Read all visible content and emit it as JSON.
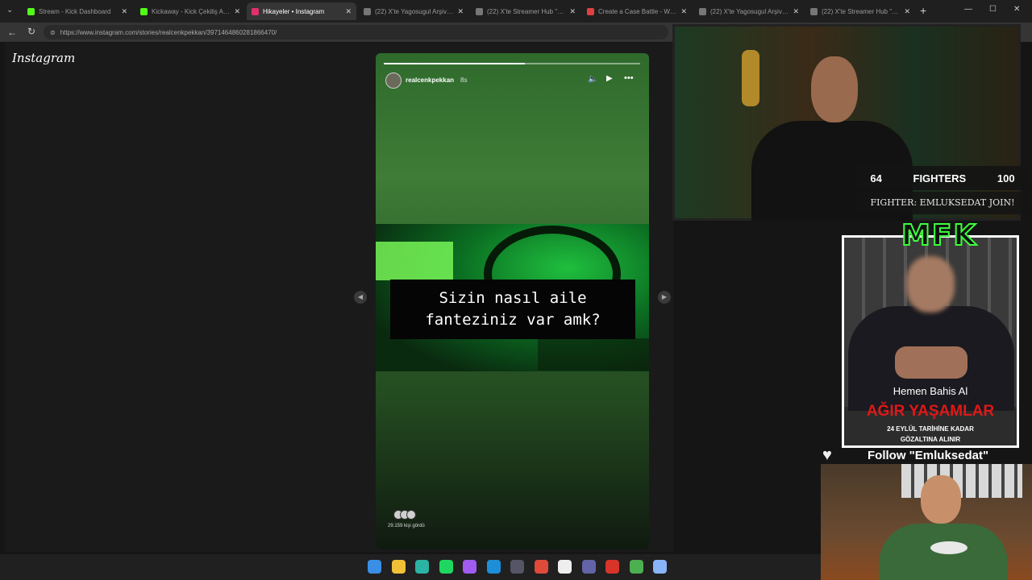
{
  "browser": {
    "tabs": [
      {
        "label": "Stream - Kick Dashboard",
        "color": "#53fc18"
      },
      {
        "label": "Kickaway - Kick Çekiliş Aracı",
        "color": "#53fc18"
      },
      {
        "label": "Hikayeler • Instagram",
        "color": "#e1306c",
        "active": true
      },
      {
        "label": "(22) X'te Yagosugul Arşiv \"...",
        "color": "#777777"
      },
      {
        "label": "(22) X'te Streamer Hub \"Gr...",
        "color": "#777777"
      },
      {
        "label": "Create a Case Battle - Win...",
        "color": "#e04040"
      },
      {
        "label": "(22) X'te Yagosugul Arşiv \"...",
        "color": "#777777"
      },
      {
        "label": "(22) X'te Streamer Hub \"Gr...",
        "color": "#777777"
      }
    ],
    "url": "https://www.instagram.com/stories/realcenkpekkan/3971464860281866470/",
    "minimize": "—",
    "maximize": "☐",
    "close": "✕"
  },
  "instagram": {
    "logo": "Instagram",
    "story": {
      "username": "realcenkpekkan",
      "time": "8s",
      "progress": 0.55,
      "caption_line1": "Sizin nasıl aile",
      "caption_line2": "fanteziniz var amk?",
      "viewers_text": "29.159 kişi gördü"
    }
  },
  "overlay": {
    "fighters_left": "64",
    "fighters_label": "FIGHTERS",
    "fighters_right": "100",
    "fighter_join": "FIGHTER: EMLUKSEDAT JOIN!",
    "mfk_logo": "MFK",
    "ad_cta": "Hemen Bahis Al",
    "ad_headline": "AĞIR YAŞAMLAR",
    "ad_sub1": "24 EYLÜL TARİHİNE KADAR",
    "ad_sub2": "GÖZALTINA ALINIR",
    "follow_text": "Follow \"Emluksedat\""
  },
  "taskbar": {
    "icons": [
      {
        "name": "windows-start-icon",
        "color": "#3a8ee6"
      },
      {
        "name": "file-explorer-icon",
        "color": "#f2c037"
      },
      {
        "name": "edge-browser-icon",
        "color": "#2bb3a3"
      },
      {
        "name": "spotify-icon",
        "color": "#1ed760"
      },
      {
        "name": "messenger-icon",
        "color": "#a05cf0"
      },
      {
        "name": "app-icon-globe",
        "color": "#1d8fd8"
      },
      {
        "name": "obs-icon",
        "color": "#555566"
      },
      {
        "name": "chrome-icon",
        "color": "#e04a3a"
      },
      {
        "name": "notion-icon",
        "color": "#eeeeee"
      },
      {
        "name": "teams-icon",
        "color": "#6264a7"
      },
      {
        "name": "app-icon-red",
        "color": "#d8342a"
      },
      {
        "name": "minecraft-icon",
        "color": "#4caf50"
      },
      {
        "name": "settings-icon",
        "color": "#8ab4f8"
      }
    ]
  }
}
